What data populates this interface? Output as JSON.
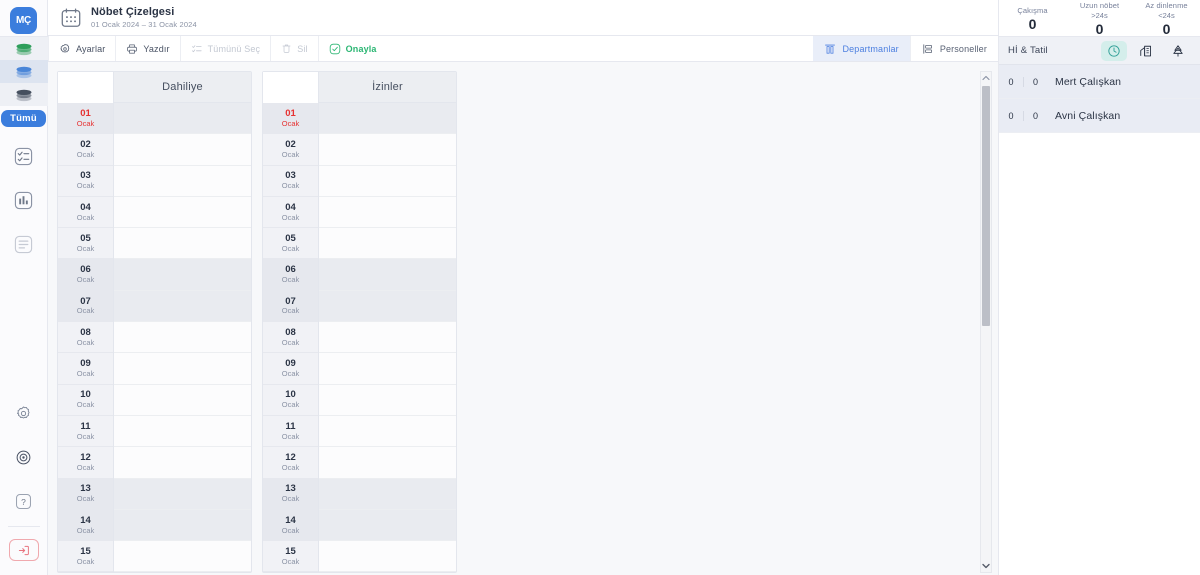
{
  "brand": {
    "logo_text": "MÇ"
  },
  "header": {
    "title": "Nöbet Çizelgesi",
    "subtitle": "01 Ocak 2024 – 31 Ocak 2024",
    "calendar_icon": "calendar-icon"
  },
  "toolbar": {
    "settings_label": "Ayarlar",
    "print_label": "Yazdır",
    "select_all_label": "Tümünü Seç",
    "delete_label": "Sil",
    "approve_label": "Onayla",
    "departments_label": "Departmanlar",
    "personnel_label": "Personeller",
    "active_tab": "Departmanlar",
    "accent_active": "#4c7fe0",
    "accent_approve": "#2bb673"
  },
  "sidebar": {
    "layers": [
      {
        "name": "layer-green",
        "color": "#2e9e5b",
        "state": "shade"
      },
      {
        "name": "layer-blue",
        "color": "#4a86d8",
        "state": "selected"
      },
      {
        "name": "layer-dark",
        "color": "#46505f",
        "state": "shade"
      }
    ],
    "all_pill_label": "Tümü",
    "items": [
      {
        "name": "tasks-icon"
      },
      {
        "name": "chart-bar-icon"
      },
      {
        "name": "document-icon"
      }
    ],
    "bottom_items": [
      {
        "name": "gear-icon"
      },
      {
        "name": "target-icon"
      },
      {
        "name": "help-icon"
      },
      {
        "name": "logout-icon"
      }
    ]
  },
  "schedule": {
    "month_label": "Ocak",
    "departments": [
      {
        "name": "Dahiliye"
      },
      {
        "name": "İzinler"
      }
    ],
    "days": [
      {
        "num": "01",
        "month": "Ocak",
        "holiday": true,
        "weekend": true
      },
      {
        "num": "02",
        "month": "Ocak",
        "holiday": false,
        "weekend": false
      },
      {
        "num": "03",
        "month": "Ocak",
        "holiday": false,
        "weekend": false
      },
      {
        "num": "04",
        "month": "Ocak",
        "holiday": false,
        "weekend": false
      },
      {
        "num": "05",
        "month": "Ocak",
        "holiday": false,
        "weekend": false
      },
      {
        "num": "06",
        "month": "Ocak",
        "holiday": false,
        "weekend": true
      },
      {
        "num": "07",
        "month": "Ocak",
        "holiday": false,
        "weekend": true
      },
      {
        "num": "08",
        "month": "Ocak",
        "holiday": false,
        "weekend": false
      },
      {
        "num": "09",
        "month": "Ocak",
        "holiday": false,
        "weekend": false
      },
      {
        "num": "10",
        "month": "Ocak",
        "holiday": false,
        "weekend": false
      },
      {
        "num": "11",
        "month": "Ocak",
        "holiday": false,
        "weekend": false
      },
      {
        "num": "12",
        "month": "Ocak",
        "holiday": false,
        "weekend": false
      },
      {
        "num": "13",
        "month": "Ocak",
        "holiday": false,
        "weekend": true
      },
      {
        "num": "14",
        "month": "Ocak",
        "holiday": false,
        "weekend": true
      },
      {
        "num": "15",
        "month": "Ocak",
        "holiday": false,
        "weekend": false
      }
    ],
    "scrollbar": {
      "up_arrow": "chevron-up-icon",
      "down_arrow": "chevron-down-icon"
    }
  },
  "right_panel": {
    "stats": [
      {
        "label_line1": "Çakışma",
        "label_line2": "",
        "value": "0"
      },
      {
        "label_line1": "Uzun nöbet",
        "label_line2": ">24s",
        "value": "0"
      },
      {
        "label_line1": "Az dinlenme",
        "label_line2": "<24s",
        "value": "0"
      }
    ],
    "panel_title": "Hİ & Tatil",
    "tabs": [
      {
        "name": "clock-icon",
        "active": true
      },
      {
        "name": "building-icon",
        "active": false
      },
      {
        "name": "tree-icon",
        "active": false
      }
    ],
    "people": [
      {
        "col1": "0",
        "col2": "0",
        "name": "Mert Çalışkan"
      },
      {
        "col1": "0",
        "col2": "0",
        "name": "Avni Çalışkan"
      }
    ]
  }
}
